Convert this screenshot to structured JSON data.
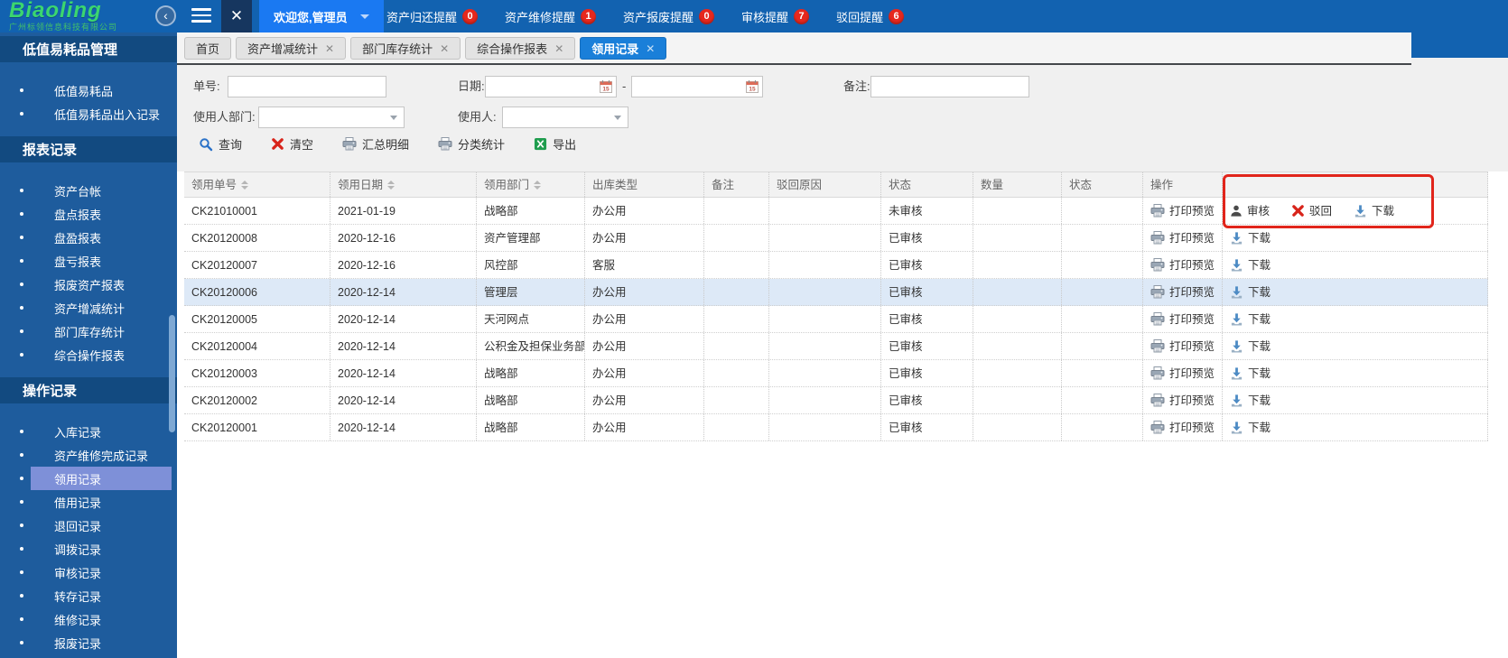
{
  "topbar": {
    "logo_title": "Biaoling",
    "logo_subtitle": "广州标领信息科技有限公司",
    "welcome": "欢迎您,管理员",
    "notifications": [
      {
        "label": "资产归还提醒",
        "count": "0"
      },
      {
        "label": "资产维修提醒",
        "count": "1"
      },
      {
        "label": "资产报废提醒",
        "count": "0"
      },
      {
        "label": "审核提醒",
        "count": "7"
      },
      {
        "label": "驳回提醒",
        "count": "6"
      }
    ]
  },
  "sidebar": {
    "sections": [
      {
        "title": "低值易耗品管理",
        "items": [
          {
            "label": "低值易耗品"
          },
          {
            "label": "低值易耗品出入记录"
          }
        ]
      },
      {
        "title": "报表记录",
        "items": [
          {
            "label": "资产台帐"
          },
          {
            "label": "盘点报表"
          },
          {
            "label": "盘盈报表"
          },
          {
            "label": "盘亏报表"
          },
          {
            "label": "报废资产报表"
          },
          {
            "label": "资产增减统计"
          },
          {
            "label": "部门库存统计"
          },
          {
            "label": "综合操作报表"
          }
        ]
      },
      {
        "title": "操作记录",
        "items": [
          {
            "label": "入库记录"
          },
          {
            "label": "资产维修完成记录"
          },
          {
            "label": "领用记录",
            "selected": true
          },
          {
            "label": "借用记录"
          },
          {
            "label": "退回记录"
          },
          {
            "label": "调拨记录"
          },
          {
            "label": "审核记录"
          },
          {
            "label": "转存记录"
          },
          {
            "label": "维修记录"
          },
          {
            "label": "报废记录"
          }
        ]
      }
    ]
  },
  "tabs": [
    {
      "label": "首页",
      "closable": false,
      "active": false
    },
    {
      "label": "资产增减统计",
      "closable": true,
      "active": false
    },
    {
      "label": "部门库存统计",
      "closable": true,
      "active": false
    },
    {
      "label": "综合操作报表",
      "closable": true,
      "active": false
    },
    {
      "label": "领用记录",
      "closable": true,
      "active": true
    }
  ],
  "filters": {
    "order_no_label": "单号:",
    "date_label": "日期:",
    "date_separator": "-",
    "remark_label": "备注:",
    "user_dept_label": "使用人部门:",
    "user_label": "使用人:"
  },
  "toolbar": {
    "buttons": [
      {
        "label": "查询",
        "icon": "search"
      },
      {
        "label": "清空",
        "icon": "clear"
      },
      {
        "label": "汇总明细",
        "icon": "printer"
      },
      {
        "label": "分类统计",
        "icon": "printer"
      },
      {
        "label": "导出",
        "icon": "excel"
      }
    ]
  },
  "table": {
    "columns": [
      {
        "label": "领用单号",
        "sortable": true
      },
      {
        "label": "领用日期",
        "sortable": true
      },
      {
        "label": "领用部门",
        "sortable": true
      },
      {
        "label": "出库类型",
        "sortable": false
      },
      {
        "label": "备注",
        "sortable": false
      },
      {
        "label": "驳回原因",
        "sortable": false
      },
      {
        "label": "状态",
        "sortable": false
      },
      {
        "label": "数量",
        "sortable": false
      },
      {
        "label": "状态",
        "sortable": false
      },
      {
        "label": "操作",
        "sortable": false
      },
      {
        "label": "",
        "sortable": false
      }
    ],
    "print_preview_label": "打印预览",
    "rows": [
      {
        "order_no": "CK21010001",
        "date": "2021-01-19",
        "dept": "战略部",
        "out_type": "办公用",
        "remark": "",
        "reject_reason": "",
        "status": "未审核",
        "quantity": "",
        "status2": "",
        "actions": [
          {
            "label": "审核",
            "icon": "user"
          },
          {
            "label": "驳回",
            "icon": "reject"
          },
          {
            "label": "下载",
            "icon": "download"
          }
        ]
      },
      {
        "order_no": "CK20120008",
        "date": "2020-12-16",
        "dept": "资产管理部",
        "out_type": "办公用",
        "remark": "",
        "reject_reason": "",
        "status": "已审核",
        "quantity": "",
        "status2": "",
        "actions": [
          {
            "label": "下载",
            "icon": "download"
          }
        ]
      },
      {
        "order_no": "CK20120007",
        "date": "2020-12-16",
        "dept": "风控部",
        "out_type": "客服",
        "remark": "",
        "reject_reason": "",
        "status": "已审核",
        "quantity": "",
        "status2": "",
        "actions": [
          {
            "label": "下载",
            "icon": "download"
          }
        ]
      },
      {
        "order_no": "CK20120006",
        "date": "2020-12-14",
        "dept": "管理层",
        "out_type": "办公用",
        "remark": "",
        "reject_reason": "",
        "status": "已审核",
        "quantity": "",
        "status2": "",
        "highlighted": true,
        "actions": [
          {
            "label": "下载",
            "icon": "download"
          }
        ]
      },
      {
        "order_no": "CK20120005",
        "date": "2020-12-14",
        "dept": "天河网点",
        "out_type": "办公用",
        "remark": "",
        "reject_reason": "",
        "status": "已审核",
        "quantity": "",
        "status2": "",
        "actions": [
          {
            "label": "下载",
            "icon": "download"
          }
        ]
      },
      {
        "order_no": "CK20120004",
        "date": "2020-12-14",
        "dept": "公积金及担保业务部",
        "out_type": "办公用",
        "remark": "",
        "reject_reason": "",
        "status": "已审核",
        "quantity": "",
        "status2": "",
        "actions": [
          {
            "label": "下载",
            "icon": "download"
          }
        ]
      },
      {
        "order_no": "CK20120003",
        "date": "2020-12-14",
        "dept": "战略部",
        "out_type": "办公用",
        "remark": "",
        "reject_reason": "",
        "status": "已审核",
        "quantity": "",
        "status2": "",
        "actions": [
          {
            "label": "下载",
            "icon": "download"
          }
        ]
      },
      {
        "order_no": "CK20120002",
        "date": "2020-12-14",
        "dept": "战略部",
        "out_type": "办公用",
        "remark": "",
        "reject_reason": "",
        "status": "已审核",
        "quantity": "",
        "status2": "",
        "actions": [
          {
            "label": "下载",
            "icon": "download"
          }
        ]
      },
      {
        "order_no": "CK20120001",
        "date": "2020-12-14",
        "dept": "战略部",
        "out_type": "办公用",
        "remark": "",
        "reject_reason": "",
        "status": "已审核",
        "quantity": "",
        "status2": "",
        "actions": [
          {
            "label": "下载",
            "icon": "download"
          }
        ]
      }
    ]
  },
  "colors": {
    "topbar_blue": "#1262b0",
    "welcome_blue": "#1a79f2",
    "sidebar_blue": "#1e5c9d",
    "section_header_blue": "#124a80",
    "selected_item": "#7e90d8",
    "active_tab": "#1a7fd9",
    "badge_red": "#e6281e",
    "annotation_red": "#e1251b",
    "row_highlight": "#dde9f7"
  }
}
